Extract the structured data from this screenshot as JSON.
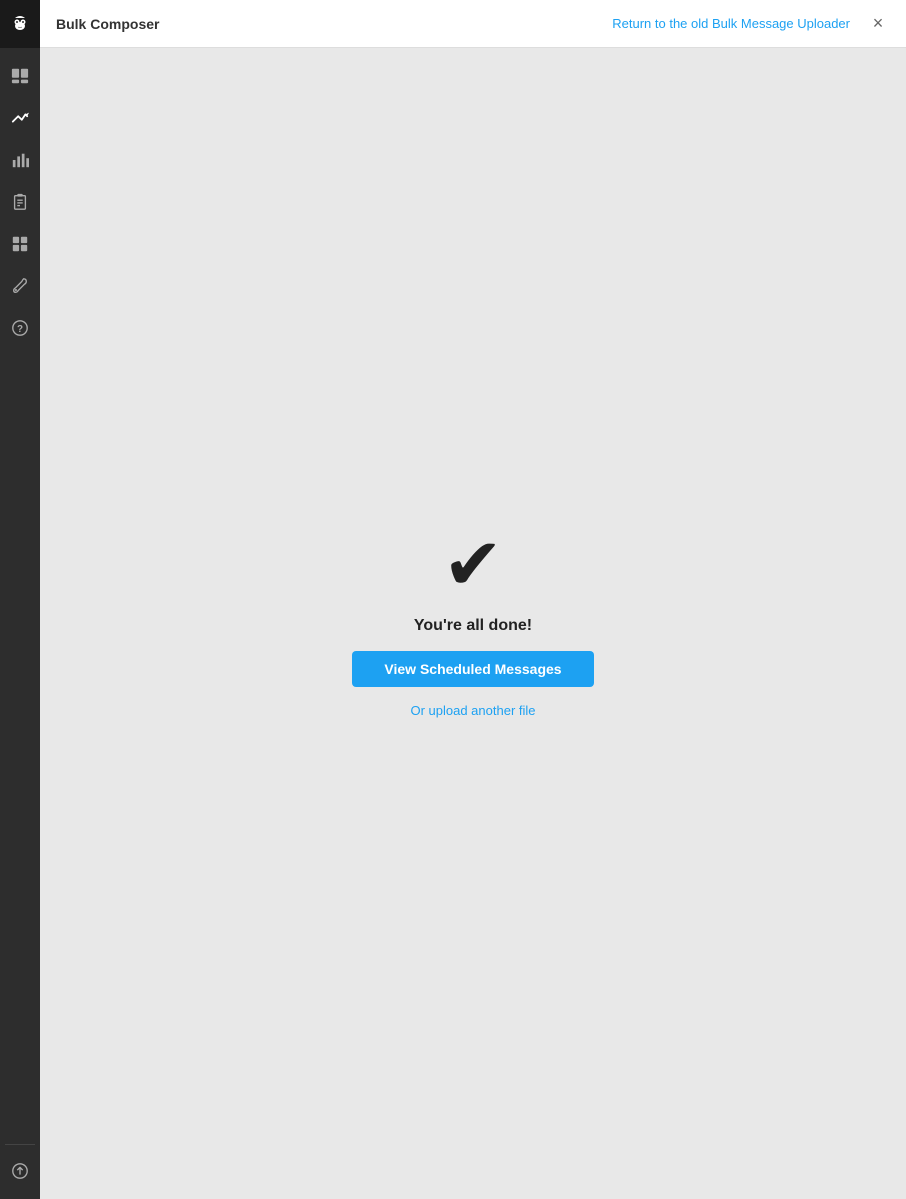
{
  "header": {
    "title": "Bulk Composer",
    "return_link": "Return to the old Bulk Message Uploader",
    "close_label": "×"
  },
  "sidebar": {
    "logo_icon": "owl-icon",
    "items": [
      {
        "name": "streams-icon",
        "icon": "streams",
        "active": false
      },
      {
        "name": "compose-icon",
        "icon": "compose",
        "active": true
      },
      {
        "name": "analytics-icon",
        "icon": "analytics",
        "active": false
      },
      {
        "name": "assignments-icon",
        "icon": "assignments",
        "active": false
      },
      {
        "name": "apps-icon",
        "icon": "apps",
        "active": false
      },
      {
        "name": "tools-icon",
        "icon": "tools",
        "active": false
      },
      {
        "name": "help-icon",
        "icon": "help",
        "active": false
      }
    ],
    "bottom_items": [
      {
        "name": "upload-icon",
        "icon": "upload"
      }
    ]
  },
  "main": {
    "success": {
      "checkmark": "✔",
      "done_text": "You're all done!",
      "view_btn_label": "View Scheduled Messages",
      "upload_link_label": "Or upload another file"
    }
  }
}
